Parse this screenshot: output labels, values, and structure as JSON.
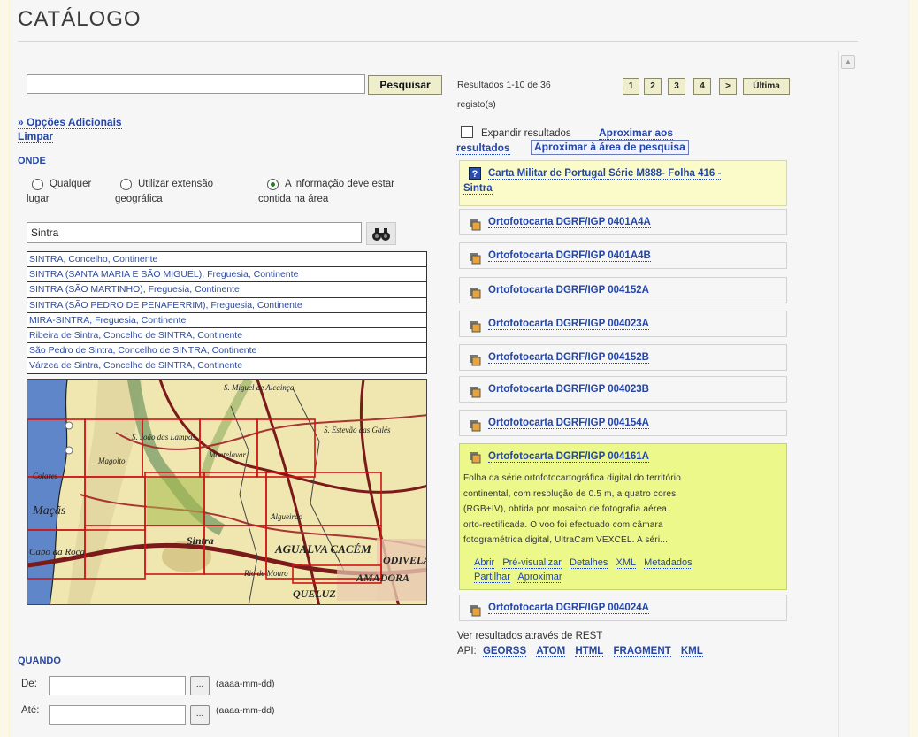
{
  "title": "CATÁLOGO",
  "search": {
    "value": "",
    "button": "Pesquisar"
  },
  "links": {
    "additional": "» Opções Adicionais",
    "clear": "Limpar"
  },
  "where": {
    "heading": "ONDE",
    "options": [
      {
        "l1": "Qualquer",
        "l2": "lugar",
        "selected": false
      },
      {
        "l1": "Utilizar extensão",
        "l2": "geográfica",
        "selected": false
      },
      {
        "l1": "A informação deve estar",
        "l2": "contida na área",
        "selected": true
      }
    ],
    "place_value": "Sintra",
    "find_icon": "binoculars-icon",
    "suggestions": [
      "SINTRA, Concelho, Continente",
      "SINTRA (SANTA MARIA E SÃO MIGUEL), Freguesia, Continente",
      "SINTRA (SÃO MARTINHO), Freguesia, Continente",
      "SINTRA (SÃO PEDRO DE PENAFERRIM), Freguesia, Continente",
      "MIRA-SINTRA, Freguesia, Continente",
      "Ribeira de Sintra, Concelho de SINTRA, Continente",
      "São Pedro de Sintra, Concelho de SINTRA, Continente",
      "Várzea de Sintra, Concelho de SINTRA, Continente"
    ],
    "map_labels": [
      "S. Miguel de Alcainça",
      "S. João das Lampas",
      "Magoito",
      "Montelavar",
      "Colares",
      "Maçãs",
      "Sintra",
      "Algueirão",
      "Rio de Mouro",
      "QUELUZ",
      "AGUALVA CACÉM",
      "ODIVELAS",
      "AMADORA",
      "Cabo da Roca",
      "S. Estevão das Galés"
    ]
  },
  "when": {
    "heading": "QUANDO",
    "from_label": "De:",
    "to_label": "Até:",
    "from_value": "",
    "to_value": "",
    "format": "(aaaa-mm-dd)",
    "picker": "..."
  },
  "results": {
    "summary_l1": "Resultados 1-10 de 36",
    "summary_l2": "registo(s)",
    "pages": [
      "1",
      "2",
      "3",
      "4",
      ">",
      "Última"
    ],
    "expand_label": "Expandir resultados",
    "zoom_results_l1": "Aproximar aos",
    "zoom_results_l2": "resultados",
    "zoom_area": "Aproximar à área de pesquisa",
    "items": [
      {
        "title_l1": "Carta Militar de Portugal Série M888- Folha 416 -",
        "title_l2": "Sintra",
        "icon": "help-icon"
      },
      {
        "title": "Ortofotocarta DGRF/IGP 0401A4A",
        "icon": "map-layer-icon"
      },
      {
        "title": "Ortofotocarta DGRF/IGP 0401A4B",
        "icon": "map-layer-icon"
      },
      {
        "title": "Ortofotocarta DGRF/IGP 004152A",
        "icon": "map-layer-icon"
      },
      {
        "title": "Ortofotocarta DGRF/IGP 004023A",
        "icon": "map-layer-icon"
      },
      {
        "title": "Ortofotocarta DGRF/IGP 004152B",
        "icon": "map-layer-icon"
      },
      {
        "title": "Ortofotocarta DGRF/IGP 004023B",
        "icon": "map-layer-icon"
      },
      {
        "title": "Ortofotocarta DGRF/IGP 004154A",
        "icon": "map-layer-icon"
      },
      {
        "title": "Ortofotocarta DGRF/IGP 004161A",
        "icon": "map-layer-icon",
        "desc": [
          "Folha da série ortofotocartográfica digital do território",
          "continental, com resolução de 0.5 m, a quatro cores",
          "(RGB+IV), obtida por mosaico de fotografia aérea",
          "orto-rectificada. O voo foi efectuado com câmara",
          "fotogramétrica digital, UltraCam VEXCEL. A séri..."
        ],
        "actions": [
          "Abrir",
          "Pré-visualizar",
          "Detalhes",
          "XML",
          "Metadados",
          "Partilhar",
          "Aproximar"
        ]
      },
      {
        "title": "Ortofotocarta DGRF/IGP 004024A",
        "icon": "map-layer-icon"
      }
    ],
    "rest_l1": "Ver resultados através de REST",
    "rest_l2": "API:",
    "rest_links": [
      "GEORSS",
      "ATOM",
      "HTML",
      "FRAGMENT",
      "KML"
    ]
  },
  "colors": {
    "highlight_yellow": "#fafbc8",
    "highlight_green": "#ecf98a",
    "link": "#2346a8"
  }
}
